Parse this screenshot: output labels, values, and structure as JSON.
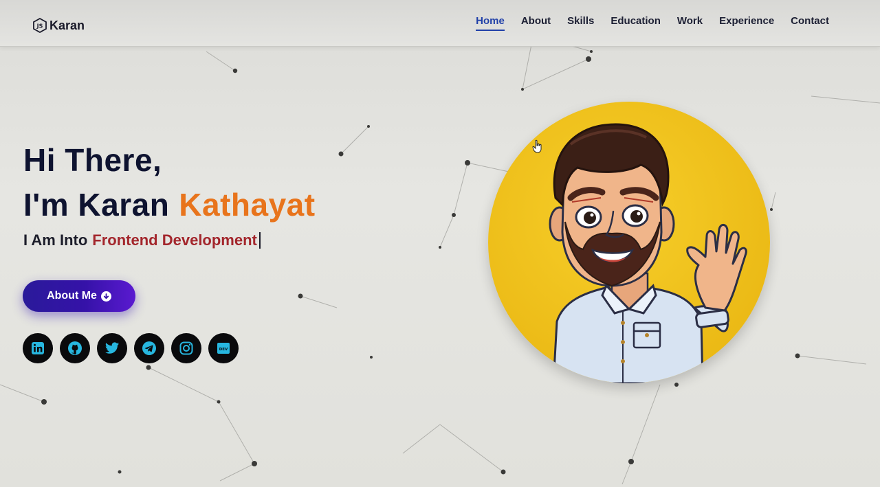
{
  "logo": {
    "icon": "js-hexagon-icon",
    "text": "Karan"
  },
  "nav": {
    "items": [
      {
        "label": "Home",
        "active": true
      },
      {
        "label": "About",
        "active": false
      },
      {
        "label": "Skills",
        "active": false
      },
      {
        "label": "Education",
        "active": false
      },
      {
        "label": "Work",
        "active": false
      },
      {
        "label": "Experience",
        "active": false
      },
      {
        "label": "Contact",
        "active": false
      }
    ]
  },
  "hero": {
    "greeting": "Hi There,",
    "name_prefix": "I'm Karan",
    "name_highlight": "Kathayat",
    "typing_prefix": "I Am Into",
    "typing_role": "Frontend Development",
    "button_label": "About Me"
  },
  "socials": [
    {
      "icon": "linkedin-icon"
    },
    {
      "icon": "github-icon"
    },
    {
      "icon": "twitter-icon"
    },
    {
      "icon": "telegram-icon"
    },
    {
      "icon": "instagram-icon"
    },
    {
      "icon": "dev-icon",
      "text": "DEV"
    }
  ],
  "colors": {
    "accent_name": "#e8741c",
    "role_text": "#a3262c",
    "nav_active": "#1f3fa8",
    "button": "#3512a8",
    "social_icon": "#27b7e0",
    "avatar_bg": "#f2c21a"
  }
}
